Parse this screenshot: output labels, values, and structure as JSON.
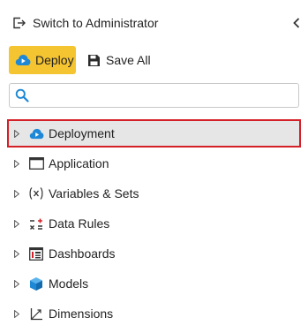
{
  "header": {
    "switch_label": "Switch to Administrator",
    "switch_icon": "exit-icon",
    "collapse_icon": "chevron-left-icon"
  },
  "toolbar": {
    "deploy_label": "Deploy",
    "deploy_icon": "cloud-deploy-icon",
    "save_all_label": "Save All",
    "save_all_icon": "floppy-disk-icon"
  },
  "search": {
    "placeholder": "",
    "value": "",
    "icon": "search-icon"
  },
  "tree": {
    "items": [
      {
        "label": "Deployment",
        "icon": "cloud-deploy-icon",
        "selected": true
      },
      {
        "label": "Application",
        "icon": "window-icon",
        "selected": false
      },
      {
        "label": "Variables & Sets",
        "icon": "function-x-icon",
        "selected": false
      },
      {
        "label": "Data Rules",
        "icon": "plus-minus-rules-icon",
        "selected": false
      },
      {
        "label": "Dashboards",
        "icon": "dashboard-grid-icon",
        "selected": false
      },
      {
        "label": "Models",
        "icon": "cube-icon",
        "selected": false
      },
      {
        "label": "Dimensions",
        "icon": "axis-icon",
        "selected": false
      }
    ]
  },
  "colors": {
    "accent_yellow": "#f5c431",
    "selection_border": "#d42028",
    "selection_bg": "#e6e6e6",
    "cloud_blue": "#1e88d6",
    "search_blue": "#1e88d6"
  }
}
